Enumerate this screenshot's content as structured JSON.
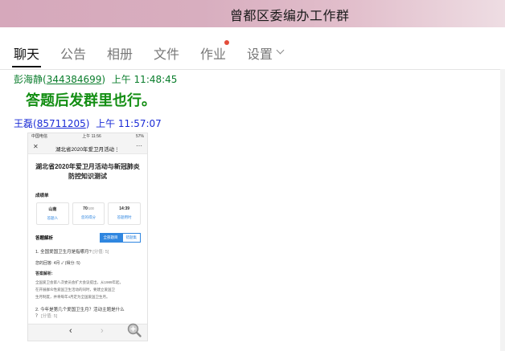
{
  "window": {
    "title": "曾都区委编办工作群"
  },
  "tabs": [
    {
      "label": "聊天",
      "active": true
    },
    {
      "label": "公告"
    },
    {
      "label": "相册"
    },
    {
      "label": "文件"
    },
    {
      "label": "作业",
      "has_dot": true
    },
    {
      "label": "设置",
      "has_dropdown": true
    }
  ],
  "messages": [
    {
      "sender": "彭海静",
      "qq": "344384699",
      "time": "上午 11:48:45",
      "text": "答题后发群里也行。",
      "color": "#0a7d2c"
    },
    {
      "sender": "王磊",
      "qq": "85711205",
      "time": "上午 11:57:07",
      "color": "#1a2bd6"
    }
  ],
  "shot": {
    "status_left": "中国电信",
    "status_time": "上午 11:56",
    "status_right": "57%",
    "nav_title": "湖北省2020年爱卫月活动⋮",
    "page_title_1": "湖北省2020年爱卫月活动与新冠肺炎",
    "page_title_2": "防控知识测试",
    "score_section": "成绩单",
    "cards": [
      {
        "value": "山南",
        "label": "答题人"
      },
      {
        "value": "70",
        "suffix": "/100",
        "label": "您的得分"
      },
      {
        "value": "14:39",
        "label": "答题用时"
      }
    ],
    "analysis_label": "答题解析",
    "btn_all": "全部题目",
    "btn_wrong": "错题集",
    "q1": "1. 全国爱国卫生月是指哪月?",
    "q1_score": "[分值: 5]",
    "q1_answer_label": "您的回答:",
    "q1_answer": "4月",
    "q1_got": "(得分: 5)",
    "explain_label": "答案解析:",
    "explain_lines": [
      "全国爱卫会第八次委员会扩大会议提出，从1989年起，",
      "在开展群众性爱国卫生活动的同时，要建立爱国卫",
      "生月制度，并将每年4月定为全国爱国卫生月。"
    ],
    "q2_line1": "2. 今年是第几个爱国卫生月？活动主题是什么",
    "q2_line2": "？",
    "q2_score": "[分值: 5]"
  },
  "colors": {
    "sender1": "#0a7d2c",
    "sender2": "#1a2bd6",
    "accent": "#2f86e0"
  }
}
